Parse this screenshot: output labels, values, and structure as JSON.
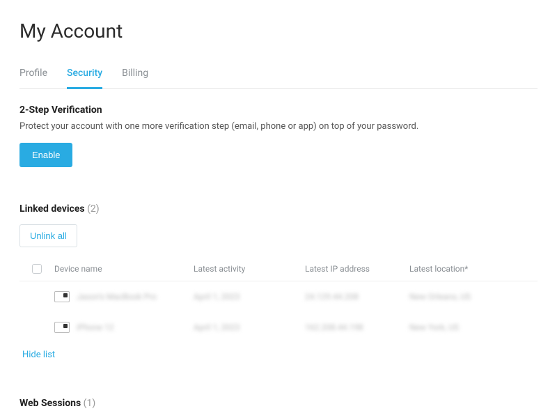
{
  "page": {
    "title": "My Account"
  },
  "tabs": {
    "profile": "Profile",
    "security": "Security",
    "billing": "Billing"
  },
  "two_step": {
    "title": "2-Step Verification",
    "desc": "Protect your account with one more verification step (email, phone or app) on top of your password.",
    "enable_label": "Enable"
  },
  "linked": {
    "title": "Linked devices",
    "count": "(2)",
    "unlink_all_label": "Unlink all",
    "columns": {
      "name": "Device name",
      "activity": "Latest activity",
      "ip": "Latest IP address",
      "location": "Latest location*"
    },
    "rows": [
      {
        "name": "Jason's MacBook Pro",
        "activity": "April 1, 2023",
        "ip": "24.129.44.208",
        "location": "New Orleans, US"
      },
      {
        "name": "iPhone 12",
        "activity": "April 1, 2023",
        "ip": "162.208.44.198",
        "location": "New York, US"
      }
    ],
    "hide_label": "Hide list"
  },
  "web_sessions": {
    "title": "Web Sessions",
    "count": "(1)"
  }
}
